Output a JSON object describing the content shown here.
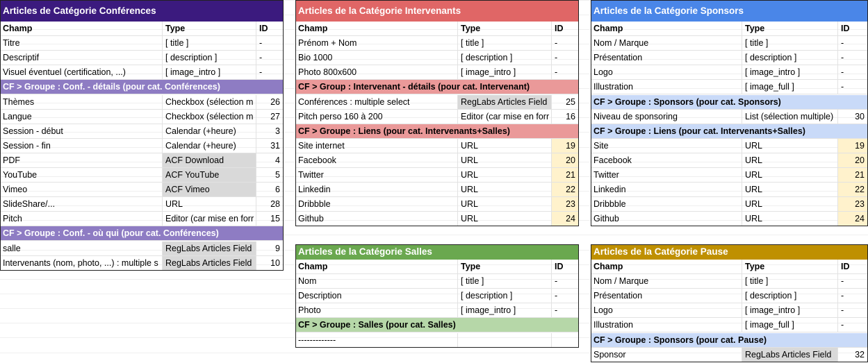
{
  "tables": [
    {
      "key": "conferences",
      "title": "Articles de Catégorie Conférences",
      "colors": {
        "title_bg": "#3b1a7e",
        "section_bg": "#8e7cc3"
      },
      "headers": [
        "Champ",
        "Type",
        "ID"
      ],
      "rows": [
        {
          "cells": [
            "Titre",
            "[ title ]",
            "-"
          ]
        },
        {
          "cells": [
            "Descriptif",
            "[ description ]",
            "-"
          ]
        },
        {
          "cells": [
            "Visuel éventuel (certification, ...)",
            "[ image_intro ]",
            "-"
          ]
        },
        {
          "section": "CF > Groupe : Conf. - détails (pour cat. Conférences)"
        },
        {
          "cells": [
            "Thèmes",
            "Checkbox (sélection m",
            "26"
          ]
        },
        {
          "cells": [
            "Langue",
            "Checkbox (sélection m",
            "27"
          ]
        },
        {
          "cells": [
            "Session - début",
            "Calendar (+heure)",
            "3"
          ]
        },
        {
          "cells": [
            "Session - fin",
            "Calendar (+heure)",
            "31"
          ]
        },
        {
          "cells": [
            "PDF",
            "ACF Download",
            "4"
          ],
          "gray": true
        },
        {
          "cells": [
            "YouTube",
            "ACF YouTube",
            "5"
          ],
          "gray": true
        },
        {
          "cells": [
            "Vimeo",
            "ACF Vimeo",
            "6"
          ],
          "gray": true
        },
        {
          "cells": [
            "SlideShare/...",
            "URL",
            "28"
          ]
        },
        {
          "cells": [
            "Pitch",
            "Editor (car mise en forr",
            "15"
          ]
        },
        {
          "section": "CF > Groupe : Conf. - où qui (pour cat. Conférences)"
        },
        {
          "cells": [
            "salle",
            "RegLabs Articles Field",
            "9"
          ],
          "gray": true
        },
        {
          "cells": [
            "Intervenants (nom, photo, ...) : multiple s",
            "RegLabs Articles Field",
            "10"
          ],
          "gray": true
        }
      ]
    },
    {
      "key": "intervenants",
      "title": "Articles de la Catégorie Intervenants",
      "colors": {
        "title_bg": "#e06666",
        "section_bg": "#ea9999"
      },
      "headers": [
        "Champ",
        "Type",
        "ID"
      ],
      "rows": [
        {
          "cells": [
            "Prénom + Nom",
            "[ title ]",
            "-"
          ]
        },
        {
          "cells": [
            "Bio 1000",
            "[ description ]",
            "-"
          ]
        },
        {
          "cells": [
            "Photo 800x600",
            "[ image_intro ]",
            "-"
          ]
        },
        {
          "section": "CF > Group : Intervenant - détails (pour cat. Intervenant)"
        },
        {
          "cells": [
            "Conférences : multiple select",
            "RegLabs Articles Field",
            "25"
          ],
          "gray": true
        },
        {
          "cells": [
            "Pitch perso 160 à 200",
            "Editor (car mise en forr",
            "16"
          ]
        },
        {
          "section": "CF > Groupe : Liens (pour cat. Intervenants+Salles)"
        },
        {
          "cells": [
            "Site internet",
            "URL",
            "19"
          ],
          "yellow": true
        },
        {
          "cells": [
            "Facebook",
            "URL",
            "20"
          ],
          "yellow": true
        },
        {
          "cells": [
            "Twitter",
            "URL",
            "21"
          ],
          "yellow": true
        },
        {
          "cells": [
            "Linkedin",
            "URL",
            "22"
          ],
          "yellow": true
        },
        {
          "cells": [
            "Dribbble",
            "URL",
            "23"
          ],
          "yellow": true
        },
        {
          "cells": [
            "Github",
            "URL",
            "24"
          ],
          "yellow": true
        }
      ]
    },
    {
      "key": "sponsors",
      "title": "Articles de la Catégorie Sponsors",
      "colors": {
        "title_bg": "#4a86e8",
        "section_bg": "#c9daf8"
      },
      "headers": [
        "Champ",
        "Type",
        "ID"
      ],
      "rows": [
        {
          "cells": [
            "Nom / Marque",
            "[ title ]",
            "-"
          ]
        },
        {
          "cells": [
            "Présentation",
            "[ description ]",
            "-"
          ]
        },
        {
          "cells": [
            "Logo",
            "[ image_intro ]",
            "-"
          ]
        },
        {
          "cells": [
            "Illustration",
            "[ image_full ]",
            "-"
          ]
        },
        {
          "section": "CF > Groupe : Sponsors (pour cat. Sponsors)"
        },
        {
          "cells": [
            "Niveau de sponsoring",
            "List (sélection multiple)",
            "30"
          ]
        },
        {
          "section": "CF > Groupe : Liens (pour cat. Intervenants+Salles)"
        },
        {
          "cells": [
            "Site",
            "URL",
            "19"
          ],
          "yellow": true
        },
        {
          "cells": [
            "Facebook",
            "URL",
            "20"
          ],
          "yellow": true
        },
        {
          "cells": [
            "Twitter",
            "URL",
            "21"
          ],
          "yellow": true
        },
        {
          "cells": [
            "Linkedin",
            "URL",
            "22"
          ],
          "yellow": true
        },
        {
          "cells": [
            "Dribbble",
            "URL",
            "23"
          ],
          "yellow": true
        },
        {
          "cells": [
            "Github",
            "URL",
            "24"
          ],
          "yellow": true
        }
      ]
    },
    {
      "key": "salles",
      "title": "Articles de la Catégorie Salles",
      "colors": {
        "title_bg": "#6aa84f",
        "section_bg": "#b6d7a8"
      },
      "headers": [
        "Champ",
        "Type",
        "ID"
      ],
      "rows": [
        {
          "cells": [
            "Nom",
            "[ title ]",
            "-"
          ]
        },
        {
          "cells": [
            "Description",
            "[ description ]",
            "-"
          ]
        },
        {
          "cells": [
            "Photo",
            "[ image_intro ]",
            "-"
          ]
        },
        {
          "section": "CF > Groupe : Salles (pour cat. Salles)"
        },
        {
          "cells": [
            "-------------",
            "",
            ""
          ]
        }
      ]
    },
    {
      "key": "pause",
      "title": "Articles de la Catégorie Pause",
      "colors": {
        "title_bg": "#bf9000",
        "section_bg": "#c9daf8"
      },
      "headers": [
        "Champ",
        "Type",
        "ID"
      ],
      "rows": [
        {
          "cells": [
            "Nom / Marque",
            "[ title ]",
            "-"
          ]
        },
        {
          "cells": [
            "Présentation",
            "[ description ]",
            "-"
          ]
        },
        {
          "cells": [
            "Logo",
            "[ image_intro ]",
            "-"
          ]
        },
        {
          "cells": [
            "Illustration",
            "[ image_full ]",
            "-"
          ]
        },
        {
          "section": "CF > Groupe : Sponsors (pour cat. Pause)"
        },
        {
          "cells": [
            "Sponsor",
            "RegLabs Articles Field",
            "32"
          ],
          "gray": true
        }
      ]
    }
  ]
}
